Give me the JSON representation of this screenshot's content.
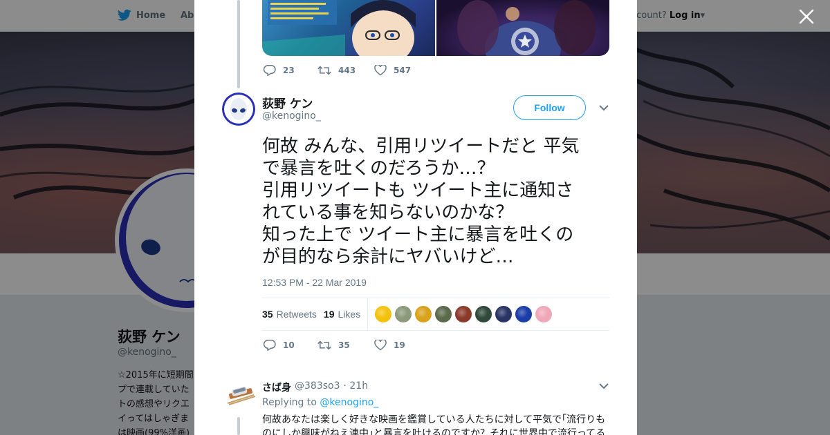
{
  "nav": {
    "home_label": "Home",
    "about_label": "Abo",
    "account_prompt": "ccount?",
    "login_label": "Log in"
  },
  "profile": {
    "name": "荻野 ケン",
    "handle": "@kenogino_",
    "bio_lines": [
      "☆2015年に短期間",
      "プで連載していた",
      "トの感想やリクエ",
      "イってはしゃぎま",
      "は映画(99%洋画)"
    ]
  },
  "previous_tweet": {
    "reply_count": "23",
    "retweet_count": "443",
    "like_count": "547"
  },
  "tweet": {
    "author_name": "荻野 ケン",
    "author_handle": "@kenogino_",
    "follow_label": "Follow",
    "text_lines": [
      "何故 みんな、引用リツイートだと 平気",
      "で暴言を吐くのだろうか…？",
      "引用リツイートも ツイート主に通知さ",
      "れている事を知らないのかな？",
      "知った上で ツイート主に暴言を吐くの",
      "が目的なら余計にヤバいけど…"
    ],
    "timestamp": "12:53 PM - 22 Mar 2019",
    "retweets_count": "35",
    "retweets_label": "Retweets",
    "likes_count": "19",
    "likes_label": "Likes",
    "liker_colors": [
      "#f4c20d",
      "#8a9a7a",
      "#d9a21b",
      "#5a6a4a",
      "#8b3a2a",
      "#2f4a3a",
      "#2a3566",
      "#1a3da8",
      "#f0a8b8"
    ],
    "reply_count": "10",
    "retweet_count": "35",
    "like_count": "19"
  },
  "reply": {
    "name": "さば身",
    "handle": "@383so3",
    "time": "· 21h",
    "replying_prefix": "Replying to",
    "replying_to": "@kenogino_",
    "text_lines": [
      "何故あなたは楽しく好きな映画を鑑賞している人たちに対して平気で｢流行りも",
      "のにしか興味がねえ連中｣と暴言を吐けるのですか？それに世界中で流行ってる"
    ]
  },
  "colors": {
    "accent": "#1da1f2",
    "muted": "#657786",
    "text": "#14171a"
  },
  "icons": [
    "twitter-bird-icon",
    "close-icon",
    "reply-icon",
    "retweet-icon",
    "like-icon",
    "chevron-down-icon"
  ]
}
